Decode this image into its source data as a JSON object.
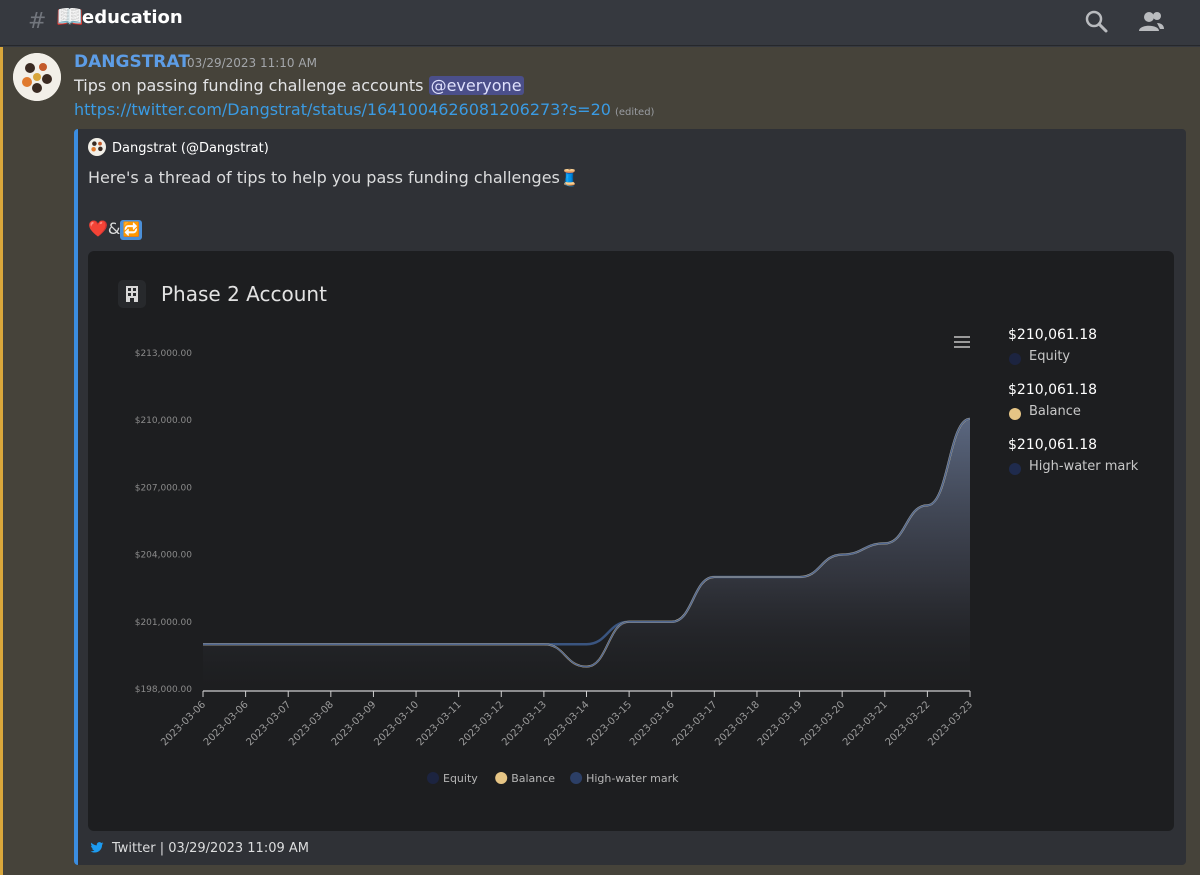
{
  "channel": {
    "name": "education",
    "book_emoji": "📖"
  },
  "message": {
    "author": "DANGSTRAT",
    "timestamp": "03/29/2023 11:10 AM",
    "text": "Tips on passing funding challenge accounts",
    "mention": "@everyone",
    "link": "https://twitter.com/Dangstrat/status/1641004626081206273?s=20",
    "edited": "(edited)"
  },
  "embed": {
    "author": "Dangstrat (@Dangstrat)",
    "description": "Here's a thread of tips to help you pass funding challenges",
    "thread_emoji": "🧵",
    "reactions_line": {
      "heart": "❤️",
      "amp": "&",
      "retweet": "🔁"
    },
    "footer": "Twitter | 03/29/2023 11:09 AM",
    "colors": {
      "accent": "#3b8de0",
      "twitter": "#1d9bf0"
    }
  },
  "chart_panel": {
    "title": "Phase 2 Account",
    "side_legend": [
      {
        "value": "$210,061.18",
        "name": "Equity",
        "color": "#1c2440"
      },
      {
        "value": "$210,061.18",
        "name": "Balance",
        "color": "#e6c585"
      },
      {
        "value": "$210,061.18",
        "name": "High-water mark",
        "color": "#1f2b4d"
      }
    ]
  },
  "chart_data": {
    "type": "area",
    "title": "Phase 2 Account",
    "x": [
      "2023-03-06",
      "2023-03-06",
      "2023-03-07",
      "2023-03-08",
      "2023-03-09",
      "2023-03-10",
      "2023-03-11",
      "2023-03-12",
      "2023-03-13",
      "2023-03-14",
      "2023-03-15",
      "2023-03-16",
      "2023-03-17",
      "2023-03-18",
      "2023-03-19",
      "2023-03-20",
      "2023-03-21",
      "2023-03-22",
      "2023-03-23"
    ],
    "series": [
      {
        "name": "Equity",
        "color": "#1c2440",
        "values": [
          200000,
          200000,
          200000,
          200000,
          200000,
          200000,
          200000,
          200000,
          200000,
          199000,
          201000,
          201000,
          203000,
          203000,
          203000,
          204000,
          204500,
          206200,
          210061.18
        ]
      },
      {
        "name": "Balance",
        "color": "#e6c585",
        "values": [
          200000,
          200000,
          200000,
          200000,
          200000,
          200000,
          200000,
          200000,
          200000,
          199000,
          201000,
          201000,
          203000,
          203000,
          203000,
          204000,
          204500,
          206200,
          210061.18
        ]
      },
      {
        "name": "High-water mark",
        "color": "#3a5580",
        "values": [
          200000,
          200000,
          200000,
          200000,
          200000,
          200000,
          200000,
          200000,
          200000,
          200000,
          201000,
          201000,
          203000,
          203000,
          203000,
          204000,
          204500,
          206200,
          210061.18
        ]
      }
    ],
    "y_ticks": [
      "$213,000.00",
      "$210,000.00",
      "$207,000.00",
      "$204,000.00",
      "$201,000.00",
      "$198,000.00"
    ],
    "ylim": [
      198000,
      213000
    ],
    "legend_placement": "bottom-center",
    "grid": false
  }
}
